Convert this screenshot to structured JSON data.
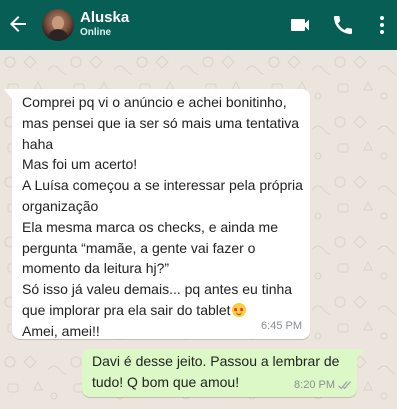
{
  "header": {
    "back_icon": "arrow-left-icon",
    "contact_name": "Aluska",
    "status": "Online",
    "icons": [
      "video-call-icon",
      "phone-icon",
      "more-vertical-icon"
    ],
    "background_color": "#075e54"
  },
  "chat": {
    "background_color": "#ece5dd",
    "messages": [
      {
        "direction": "incoming",
        "text": "Comprei pq vi o anúncio e achei bonitinho, mas pensei que ia ser só mais uma tentativa haha\nMas foi um acerto!\nA Luísa começou a se interessar pela própria organização\nEla mesma marca os checks, e ainda me pergunta “mamãe, a gente vai fazer o momento da leitura hj?”\nSó isso já valeu demais... pq antes eu tinha que implorar pra ela sair do tablet",
        "emoji": "smiling-face-with-hearts-emoji",
        "text_after_emoji": "\nAmei, amei!!",
        "time": "6:45 PM",
        "bubble_color": "#ffffff"
      },
      {
        "direction": "outgoing",
        "text": "Davi é desse jeito. Passou a lembrar de tudo! Q bom que amou!",
        "time": "8:20 PM",
        "status_icon": "double-check-icon",
        "bubble_color": "#dcf8c6"
      }
    ]
  }
}
